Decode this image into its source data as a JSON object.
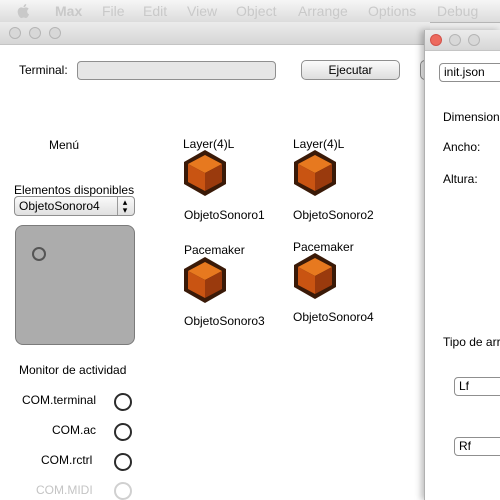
{
  "menubar": {
    "items": [
      "Max",
      "File",
      "Edit",
      "View",
      "Object",
      "Arrange",
      "Options",
      "Debug"
    ]
  },
  "main": {
    "terminal_label": "Terminal:",
    "terminal_value": "",
    "execute_label": "Ejecutar",
    "menu_label": "Menú",
    "available_label": "Elementos disponibles",
    "selected_element": "ObjetoSonoro4",
    "select_arrows": "▴▾",
    "objects": [
      {
        "title": "Layer(4)L",
        "name": "ObjetoSonoro1"
      },
      {
        "title": "Layer(4)L",
        "name": "ObjetoSonoro2"
      },
      {
        "title": "Pacemaker",
        "name": "ObjetoSonoro3"
      },
      {
        "title": "Pacemaker",
        "name": "ObjetoSonoro4"
      }
    ],
    "monitor": {
      "title": "Monitor de actividad",
      "items": [
        "COM.terminal",
        "COM.ac",
        "COM.rctrl",
        "COM.MIDI"
      ]
    }
  },
  "side": {
    "file_value": "init.json",
    "dimension_label": "Dimension",
    "width_label": "Ancho:",
    "height_label": "Altura:",
    "type_label": "Tipo de arr",
    "field1_value": "Lf",
    "field2_value": "Rf"
  },
  "colors": {
    "cube_outline": "#3a1a08",
    "cube_top": "#e7791f",
    "cube_left": "#c95412",
    "cube_right": "#9a3a0d"
  },
  "icons": {
    "apple": "apple-icon",
    "cube": "cube-icon"
  }
}
